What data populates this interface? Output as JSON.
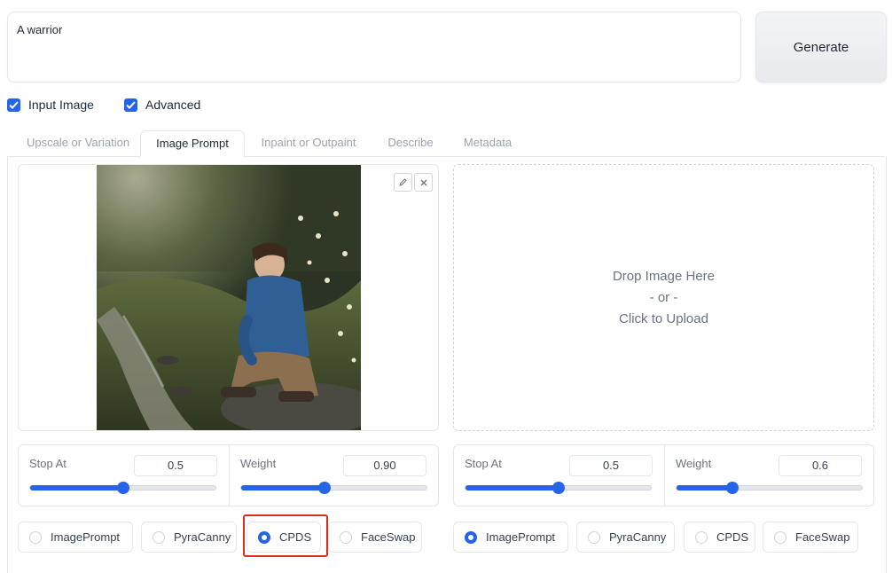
{
  "prompt": {
    "value": "A warrior"
  },
  "generate_label": "Generate",
  "checkboxes": [
    {
      "label": "Input Image",
      "checked": true
    },
    {
      "label": "Advanced",
      "checked": true
    }
  ],
  "tabs": [
    {
      "label": "Upscale or Variation",
      "active": false
    },
    {
      "label": "Image Prompt",
      "active": true
    },
    {
      "label": "Inpaint or Outpaint",
      "active": false
    },
    {
      "label": "Describe",
      "active": false
    },
    {
      "label": "Metadata",
      "active": false
    }
  ],
  "upload": {
    "line1": "Drop Image Here",
    "line2": "- or -",
    "line3": "Click to Upload"
  },
  "left_sliders": {
    "stop_at": {
      "label": "Stop At",
      "value": "0.5",
      "fraction": 0.5
    },
    "weight": {
      "label": "Weight",
      "value": "0.90",
      "fraction": 0.45
    }
  },
  "right_sliders": {
    "stop_at": {
      "label": "Stop At",
      "value": "0.5",
      "fraction": 0.5
    },
    "weight": {
      "label": "Weight",
      "value": "0.6",
      "fraction": 0.3
    }
  },
  "left_modes": [
    {
      "label": "ImagePrompt",
      "selected": false
    },
    {
      "label": "PyraCanny",
      "selected": false
    },
    {
      "label": "CPDS",
      "selected": true
    },
    {
      "label": "FaceSwap",
      "selected": false
    }
  ],
  "right_modes": [
    {
      "label": "ImagePrompt",
      "selected": true
    },
    {
      "label": "PyraCanny",
      "selected": false
    },
    {
      "label": "CPDS",
      "selected": false
    },
    {
      "label": "FaceSwap",
      "selected": false
    }
  ],
  "colors": {
    "accent": "#2563eb",
    "highlight": "#d92d20"
  },
  "icons": [
    "edit-icon",
    "close-icon",
    "checkmark-icon"
  ]
}
